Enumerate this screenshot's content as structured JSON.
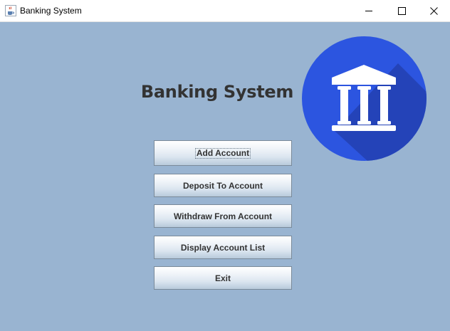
{
  "window": {
    "title": "Banking System",
    "app_icon": "java-cup-icon",
    "controls": {
      "minimize_icon": "minimize-icon",
      "maximize_icon": "maximize-icon",
      "close_icon": "close-icon"
    }
  },
  "main": {
    "heading": "Banking System",
    "logo_icon": "bank-building-icon",
    "buttons": [
      {
        "label": "Add Account",
        "focused": true
      },
      {
        "label": "Deposit To Account"
      },
      {
        "label": "Withdraw From Account"
      },
      {
        "label": "Display Account List"
      },
      {
        "label": "Exit"
      }
    ]
  },
  "colors": {
    "background": "#99b4d1",
    "logo_circle": "#2c55e0",
    "logo_shadow": "#2443b8",
    "heading_text": "#333333"
  }
}
